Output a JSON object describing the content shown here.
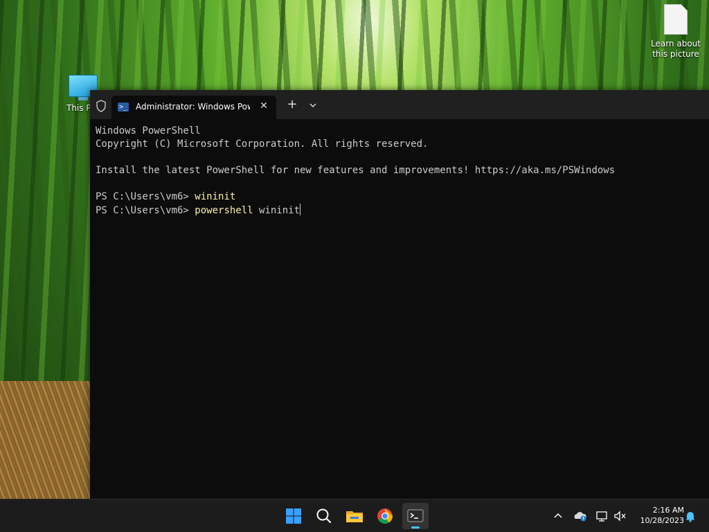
{
  "desktop": {
    "icons": [
      {
        "label": "This PC",
        "visible_label": "This P"
      },
      {
        "label": "Learn about this picture"
      }
    ]
  },
  "terminal": {
    "tab_title": "Administrator: Windows PowerShell",
    "tab_close": "✕",
    "new_tab": "+",
    "lines": {
      "l1": "Windows PowerShell",
      "l2": "Copyright (C) Microsoft Corporation. All rights reserved.",
      "l3": "",
      "l4": "Install the latest PowerShell for new features and improvements! https://aka.ms/PSWindows",
      "l5": ""
    },
    "prompt1": "PS C:\\Users\\vm6> ",
    "cmd1": "wininit",
    "prompt2": "PS C:\\Users\\vm6> ",
    "cmd2": "powershell",
    "arg2": " wininit"
  },
  "taskbar": {
    "icons": [
      "windows-start-icon",
      "search-icon",
      "file-explorer-icon",
      "chrome-icon",
      "terminal-icon"
    ],
    "tray_icons": [
      "chevron-up-icon",
      "onedrive-icon",
      "network-icon",
      "volume-muted-icon",
      "notification-bell-icon"
    ],
    "time": "2:16 AM",
    "date": "10/28/2023"
  },
  "colors": {
    "terminal_bg": "#0c0c0c",
    "titlebar_bg": "#202020",
    "command_yellow": "#f9f1a5",
    "taskbar_bg": "#1c1c1c",
    "accent": "#4cc2ff"
  }
}
